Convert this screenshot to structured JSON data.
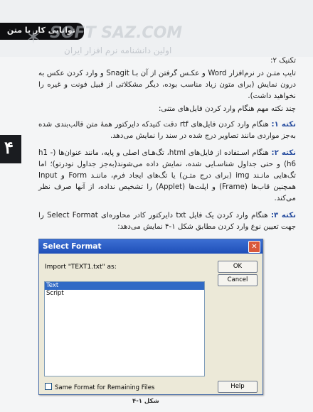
{
  "header": {
    "chapter_title": "توانایی کار با متن",
    "watermark_line1": "SOFT SAZ.COM",
    "watermark_line2": "اولین دانشنامه نرم افزار ایران"
  },
  "side_tab": {
    "number": "۴"
  },
  "body": {
    "heading": "تکنیک ۲:",
    "paragraph": "تایپ متـن در نرم‌افزار Word و عکـس گرفتن از آن بـا Snagit و وارد کردن عکس به درون نمایش (برای متون زیاد مناسب بوده، دیگر مشکلاتی از قبیل فونت و غیره را نخواهید داشت).",
    "note_intro": "چند نکته مهم هنگام وارد کردن فایل‌های متنی:",
    "notes": [
      {
        "label": "نکته ۱:",
        "text": "هنگام وارد کردن فایل‌های rtf دقت کنیدکه دایرکتور همۀ متن قالب‌بندی شده به‌جز مواردی مانند تصاویر درج شده در سند را نمایش می‌دهد."
      },
      {
        "label": "نکته ۲:",
        "text": "هنگام اسـتفاده از فایل‌های html، تگ‌هـای اصلی و پایه، مانند عنوان‌ها (h1 - h6) و حتی جداول شناسـایی شده، نمایش داده می‌شوند(به‌جز جداول تودرتو)؛ اما تگ‌هایی مانـند img (برای درج متـن) یا تگ‌های ایجاد فرم، ماننـد Form و Input همچنین قاب‌ها (Frame) و اپلت‌ها (Applet) را تشخیص نداده، از آنها صرف نظر می‌کند."
      },
      {
        "label": "نکته ۳:",
        "text": "هنگام وارد کردن یک فایل txt دایرکتور کادر محاوره‌ای Select Format را جهت تعیین نوع وارد کردن مطابق شکل ۱-۴ نمایش می‌دهد:"
      }
    ]
  },
  "dialog": {
    "title": "Select Format",
    "close_symbol": "✕",
    "import_label": "Import \"TEXT1.txt\" as:",
    "ok_label": "OK",
    "cancel_label": "Cancel",
    "help_label": "Help",
    "options": [
      "Text",
      "Script"
    ],
    "selected_option": "Text",
    "checkbox_label": "Same Format for Remaining Files"
  },
  "figure_caption": "شکل ۱-۴"
}
